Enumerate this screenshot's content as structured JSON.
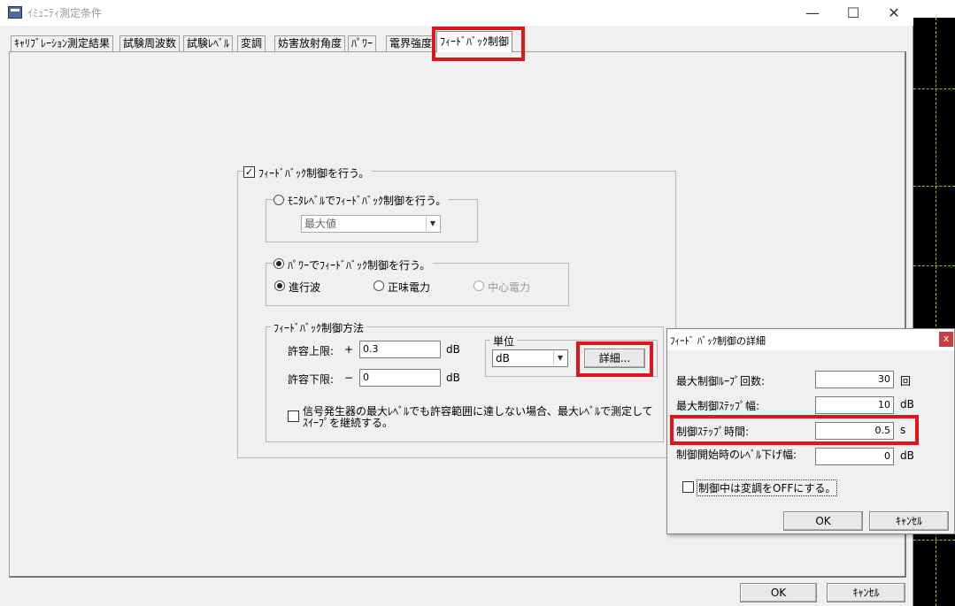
{
  "window": {
    "title": "ｲﾐｭﾆﾃｨ測定条件",
    "minimize": "—",
    "maximize": "☐",
    "close": "✕"
  },
  "tabs": [
    {
      "label": "ｷｬﾘﾌﾞﾚｰｼｮﾝ測定結果"
    },
    {
      "label": "試験周波数"
    },
    {
      "label": "試験ﾚﾍﾞﾙ"
    },
    {
      "label": "変調"
    },
    {
      "label": "妨害放射角度"
    },
    {
      "label": "ﾊﾟﾜｰ"
    },
    {
      "label": "電界強度"
    },
    {
      "label": "ﾌｨｰﾄﾞﾊﾞｯｸ制御"
    }
  ],
  "feedback": {
    "enable_label": "ﾌｨｰﾄﾞﾊﾞｯｸ制御を行う。",
    "enable_checked": true,
    "monitor": {
      "label": "ﾓﾆﾀﾚﾍﾞﾙでﾌｨｰﾄﾞﾊﾞｯｸ制御を行う。",
      "selected": false,
      "select_value": "最大値"
    },
    "power": {
      "label": "ﾊﾟﾜｰでﾌｨｰﾄﾞﾊﾞｯｸ制御を行う。",
      "selected": true,
      "options": [
        {
          "label": "進行波",
          "selected": true,
          "enabled": true
        },
        {
          "label": "正味電力",
          "selected": false,
          "enabled": true
        },
        {
          "label": "中心電力",
          "selected": false,
          "enabled": false
        }
      ]
    },
    "method": {
      "label": "ﾌｨｰﾄﾞﾊﾞｯｸ制御方法",
      "upper_label": "許容上限:",
      "upper_sign": "+",
      "upper_value": "0.3",
      "upper_unit": "dB",
      "lower_label": "許容下限:",
      "lower_sign": "−",
      "lower_value": "0",
      "lower_unit": "dB",
      "unit_group_label": "単位",
      "unit_value": "dB",
      "detail_button": "詳細...",
      "continue_label_line1": "信号発生器の最大ﾚﾍﾞﾙでも許容範囲に達しない場合、最大ﾚﾍﾞﾙで測定して",
      "continue_label_line2": "ｽｲｰﾌﾟを継続する。",
      "continue_checked": false
    }
  },
  "footer": {
    "ok": "OK",
    "cancel": "ｷｬﾝｾﾙ"
  },
  "detail_dialog": {
    "title": "ﾌｨｰﾄﾞ ﾊﾞｯｸ制御の詳細",
    "close": "x",
    "rows": [
      {
        "label": "最大制御ﾙｰﾌﾟ回数:",
        "value": "30",
        "unit": "回"
      },
      {
        "label": "最大制御ｽﾃｯﾌﾟ幅:",
        "value": "10",
        "unit": "dB"
      },
      {
        "label": "制御ｽﾃｯﾌﾟ時間:",
        "value": "0.5",
        "unit": "s"
      },
      {
        "label": "制御開始時のﾚﾍﾞﾙ下げ幅:",
        "value": "0",
        "unit": "dB"
      }
    ],
    "mod_off_label": "制御中は変調をOFFにする。",
    "mod_off_checked": false,
    "ok": "OK",
    "cancel": "ｷｬﾝｾﾙ"
  },
  "colors": {
    "highlight": "#e0151b",
    "background": "#f0f0f0"
  }
}
